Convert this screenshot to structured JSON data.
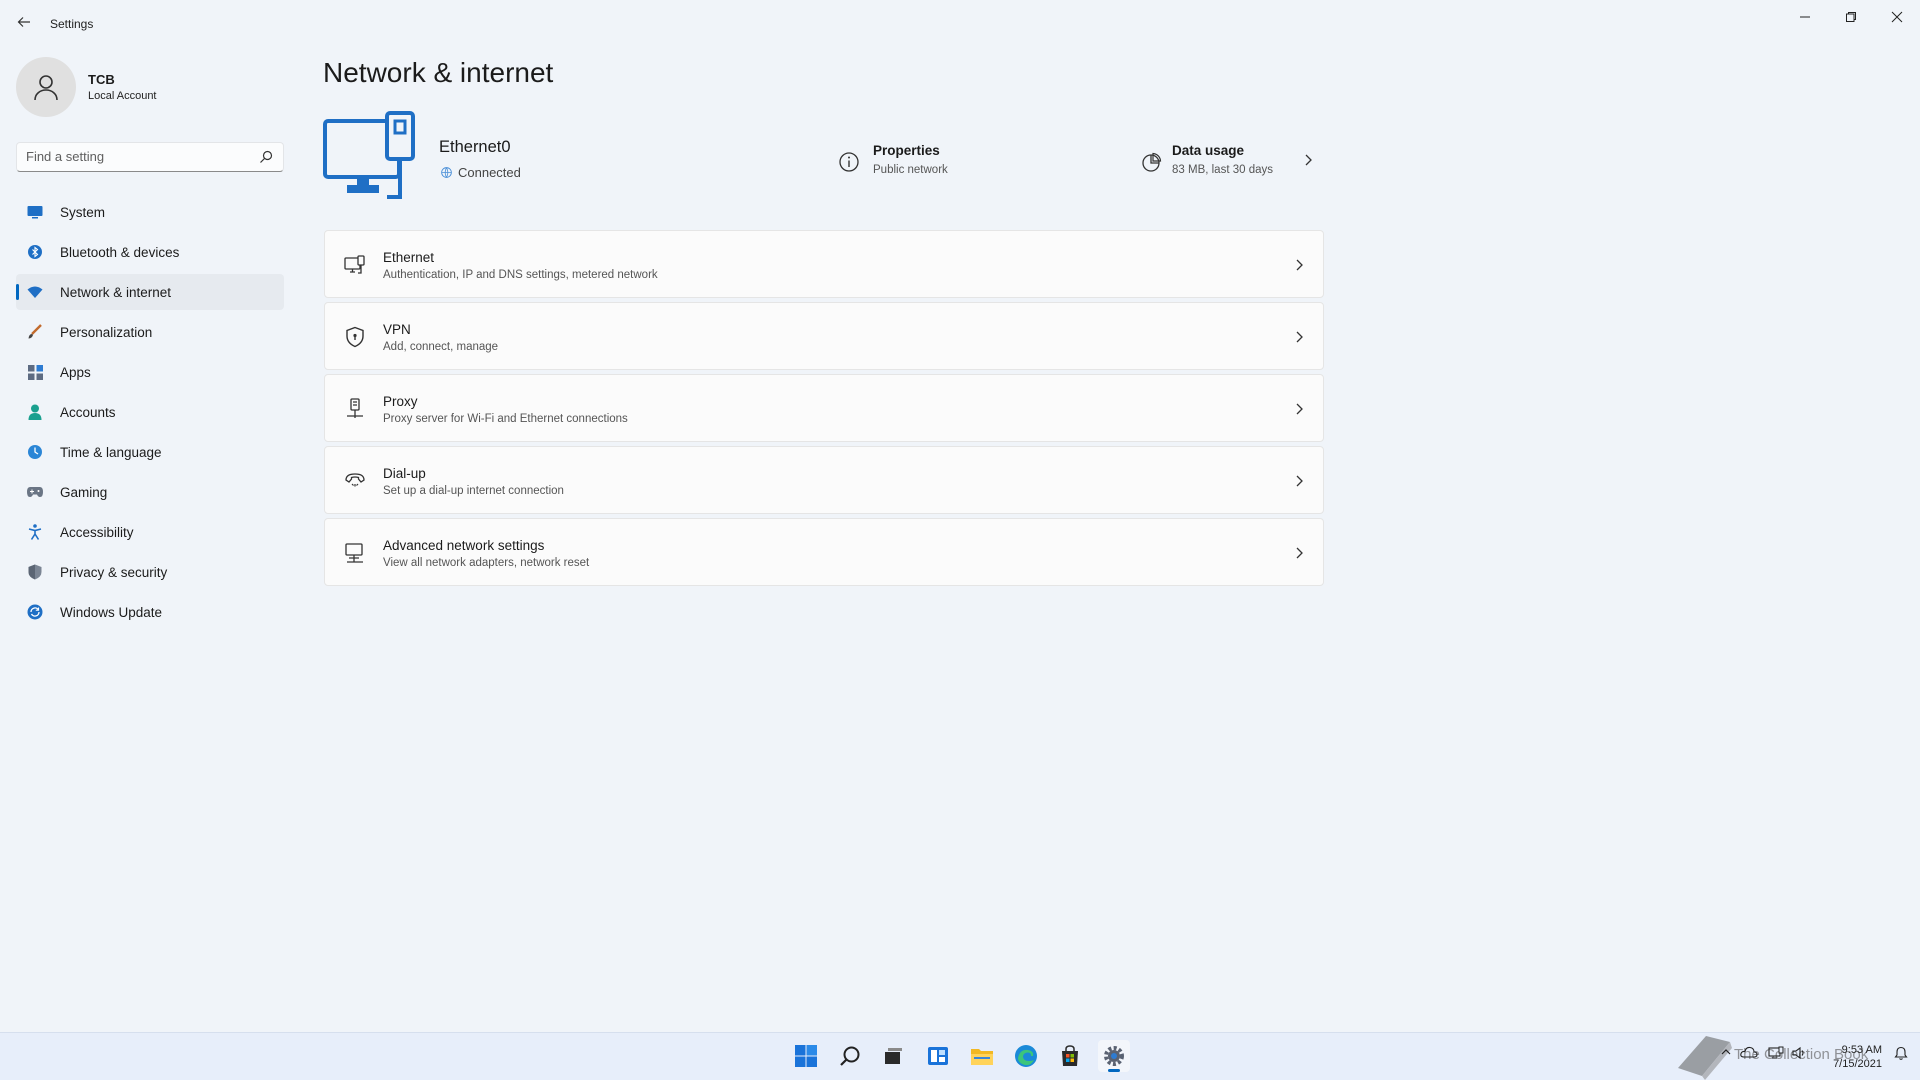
{
  "window": {
    "title": "Settings",
    "back_icon": "back-arrow-icon"
  },
  "profile": {
    "name": "TCB",
    "account_type": "Local Account"
  },
  "search": {
    "placeholder": "Find a setting"
  },
  "sidebar": {
    "items": [
      {
        "label": "System",
        "icon": "system-icon"
      },
      {
        "label": "Bluetooth & devices",
        "icon": "bluetooth-icon"
      },
      {
        "label": "Network & internet",
        "icon": "network-icon",
        "active": true
      },
      {
        "label": "Personalization",
        "icon": "brush-icon"
      },
      {
        "label": "Apps",
        "icon": "apps-icon"
      },
      {
        "label": "Accounts",
        "icon": "accounts-icon"
      },
      {
        "label": "Time & language",
        "icon": "time-language-icon"
      },
      {
        "label": "Gaming",
        "icon": "gaming-icon"
      },
      {
        "label": "Accessibility",
        "icon": "accessibility-icon"
      },
      {
        "label": "Privacy & security",
        "icon": "shield-icon"
      },
      {
        "label": "Windows Update",
        "icon": "update-icon"
      }
    ]
  },
  "main": {
    "title": "Network & internet",
    "connection": {
      "name": "Ethernet0",
      "status": "Connected"
    },
    "properties": {
      "title": "Properties",
      "subtitle": "Public network"
    },
    "data_usage": {
      "title": "Data usage",
      "subtitle": "83 MB, last 30 days"
    },
    "cards": [
      {
        "title": "Ethernet",
        "subtitle": "Authentication, IP and DNS settings, metered network",
        "icon": "ethernet-icon"
      },
      {
        "title": "VPN",
        "subtitle": "Add, connect, manage",
        "icon": "vpn-shield-icon"
      },
      {
        "title": "Proxy",
        "subtitle": "Proxy server for Wi-Fi and Ethernet connections",
        "icon": "proxy-icon"
      },
      {
        "title": "Dial-up",
        "subtitle": "Set up a dial-up internet connection",
        "icon": "dialup-icon"
      },
      {
        "title": "Advanced network settings",
        "subtitle": "View all network adapters, network reset",
        "icon": "advanced-network-icon"
      }
    ]
  },
  "taskbar": {
    "apps": [
      "start-icon",
      "search-icon",
      "task-view-icon",
      "widgets-icon",
      "file-explorer-icon",
      "edge-icon",
      "store-icon",
      "settings-icon"
    ],
    "clock_time": "9:53 AM",
    "clock_date": "7/15/2021",
    "watermark_text": "The Collection Book"
  },
  "colors": {
    "accent": "#0067c0",
    "background": "#f0f4f9",
    "card": "#fbfbfb"
  }
}
